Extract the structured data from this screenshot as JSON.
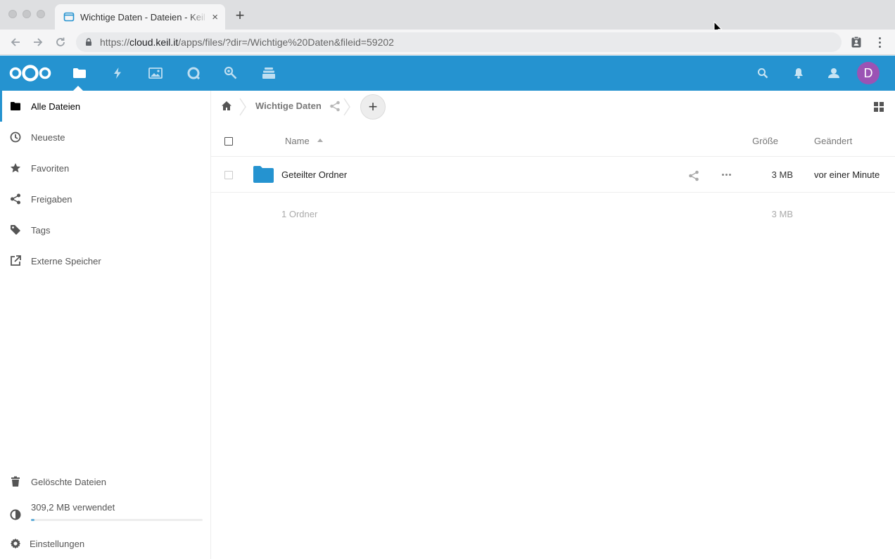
{
  "browser": {
    "tab": {
      "title": "Wichtige Daten - Dateien - Keil IT Cloud",
      "close": "×"
    },
    "new_tab": "+",
    "url": {
      "scheme": "https://",
      "host": "cloud.keil.it",
      "path": "/apps/files/?dir=/Wichtige%20Daten&fileid=59202"
    }
  },
  "header": {
    "apps": [
      "files-icon",
      "activity-icon",
      "gallery-icon",
      "talk-icon",
      "search-app-icon",
      "deck-icon"
    ],
    "avatar_letter": "D",
    "avatar_color": "#9b53b4",
    "brand_color": "#2593d0"
  },
  "sidebar": {
    "items": [
      {
        "label": "Alle Dateien",
        "icon": "folder-icon"
      },
      {
        "label": "Neueste",
        "icon": "clock-icon"
      },
      {
        "label": "Favoriten",
        "icon": "star-icon"
      },
      {
        "label": "Freigaben",
        "icon": "share-icon"
      },
      {
        "label": "Tags",
        "icon": "tag-icon"
      },
      {
        "label": "Externe Speicher",
        "icon": "external-link-icon"
      }
    ],
    "deleted": "Gelöschte Dateien",
    "quota": {
      "label": "309,2 MB verwendet",
      "fraction": 0.02
    },
    "settings": "Einstellungen"
  },
  "breadcrumb": {
    "current": "Wichtige Daten"
  },
  "table": {
    "headers": {
      "name": "Name",
      "size": "Größe",
      "modified": "Geändert"
    },
    "rows": [
      {
        "name": "Geteilter Ordner",
        "size": "3 MB",
        "modified": "vor einer Minute"
      }
    ],
    "summary": {
      "text": "1 Ordner",
      "size": "3 MB"
    }
  }
}
